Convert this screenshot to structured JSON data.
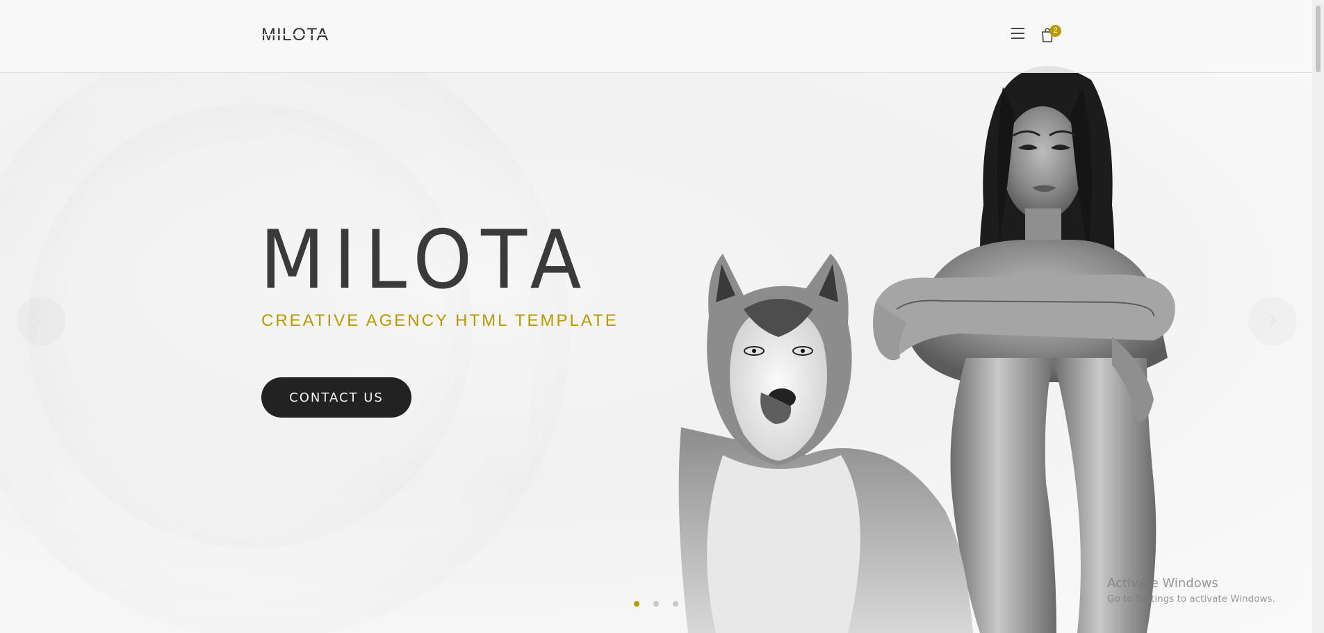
{
  "header": {
    "logo_text": "MILOTA",
    "cart_count": "2"
  },
  "hero": {
    "title": "MILOTA",
    "subtitle": "CREATIVE AGENCY HTML TEMPLATE",
    "cta_label": "CONTACT US"
  },
  "slider": {
    "slide_count": 3,
    "active_slide": 1
  },
  "watermark": {
    "line1": "Activate Windows",
    "line2": "Go to Settings to activate Windows."
  },
  "colors": {
    "accent": "#b89900",
    "button_bg": "#222222",
    "title": "#3a3a3a"
  },
  "icons": [
    "menu-icon",
    "shopping-bag-icon",
    "chevron-left-icon",
    "chevron-right-icon"
  ]
}
